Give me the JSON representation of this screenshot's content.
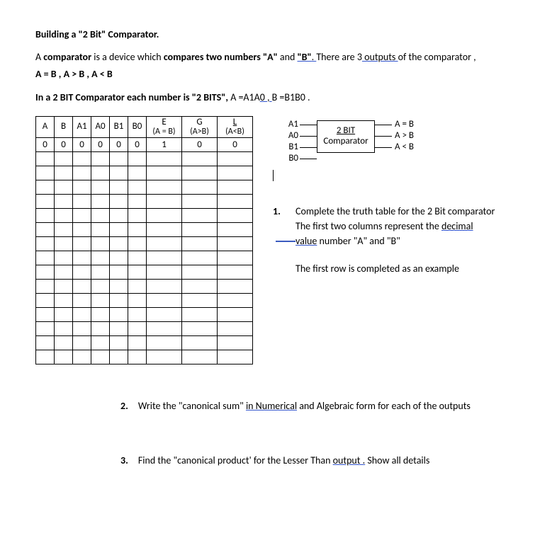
{
  "title": "Building a \"2 Bit\" Comparator.",
  "intro": {
    "line1_a": "A ",
    "line1_b": "comparator",
    "line1_c": " is a device which ",
    "line1_d": "compares two numbers \"A\"",
    "line1_e": " and ",
    "line1_f": "\"B\"",
    "line1_g": ".  ",
    "line1_h": "There are 3",
    "line1_i": " outputs ",
    "line1_j": "of the comparator ,",
    "line2": "A = B ,   A > B  ,  A < B",
    "line3_a": "In a 2 BIT Comparator each number is \"2 BITS\", ",
    "line3_b": "A =A1A",
    "line3_c": "0 , ",
    "line3_d": "B =B1B0 ."
  },
  "table": {
    "headers": {
      "a": "A",
      "b": "B",
      "a1": "A1",
      "a0": "A0",
      "b1": "B1",
      "b0": "B0",
      "e_top": "E",
      "e_sub": "(A = B)",
      "g_top": "G",
      "g_sub": "(A>B)",
      "l_top": "L",
      "l_sub": "(A<B)"
    },
    "row0": {
      "a": "0",
      "b": "0",
      "a1": "0",
      "a0": "0",
      "b1": "0",
      "b0": "0",
      "e": "1",
      "g": "0",
      "l": "0"
    }
  },
  "diagram": {
    "box_line1": "2 BIT",
    "box_line2": "Comparator",
    "in": [
      "A1",
      "A0",
      "B1",
      "B0"
    ],
    "out": [
      "A = B",
      "A > B",
      "A < B"
    ]
  },
  "questions": {
    "q1_num": "1.",
    "q1_l1": "Complete the truth table for the 2 Bit comparator",
    "q1_l2a": "The first two columns represent the ",
    "q1_l2b": "decimal ",
    "q1_l3a": "value",
    "q1_l3b": " number \"A\" and \"B\"",
    "q1_l4": "The first row is completed as an example",
    "q2_num": "2.",
    "q2_a": "Write the \"canonical sum\" ",
    "q2_b": "in  Numerical",
    "q2_c": " and Algebraic form for each of the outputs",
    "q3_num": "3.",
    "q3_a": "Find the \"canonical product' for the Lesser Than ",
    "q3_b": "output .",
    "q3_c": "  Show all details"
  }
}
